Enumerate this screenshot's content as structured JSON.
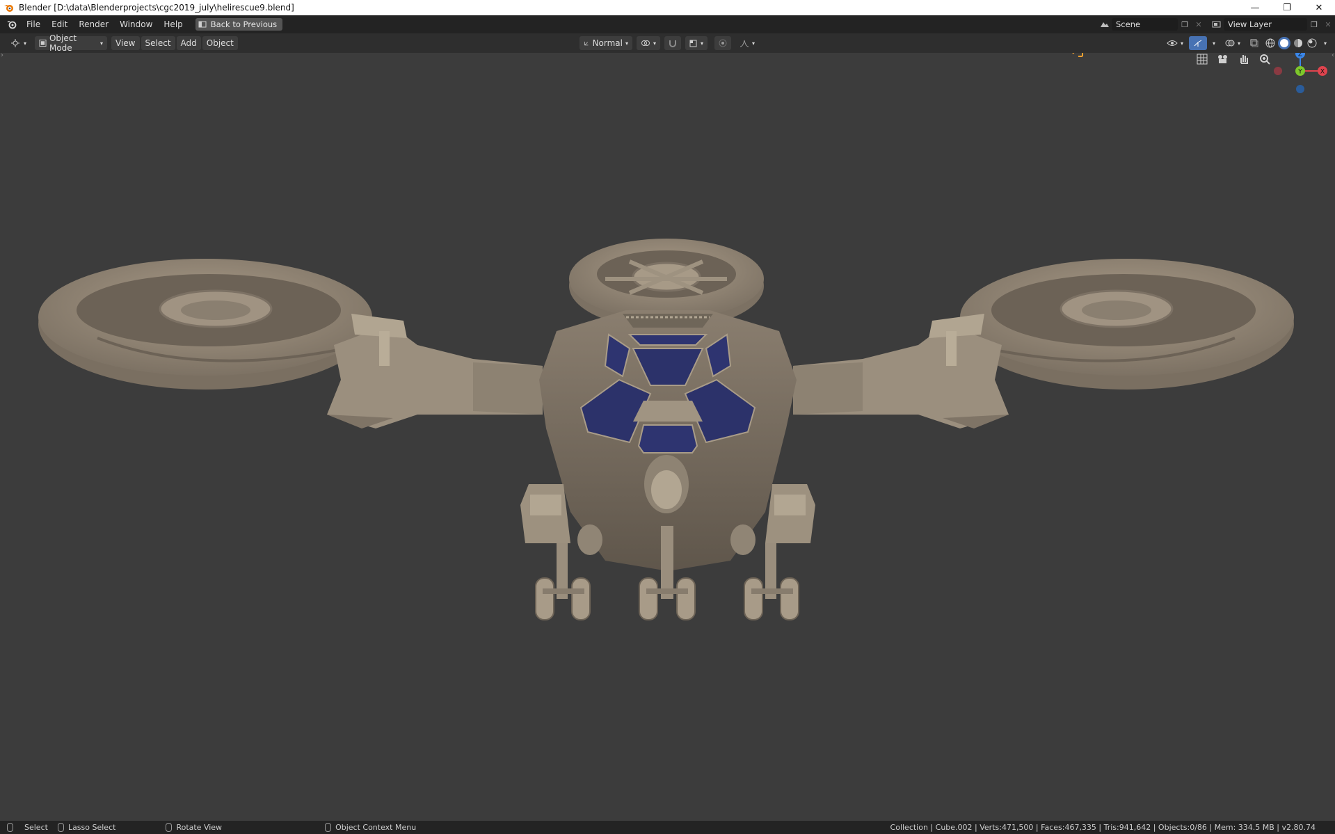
{
  "window": {
    "title": "Blender [D:\\data\\Blenderprojects\\cgc2019_july\\helirescue9.blend]",
    "controls": {
      "minimize": "—",
      "restore": "❐",
      "close": "✕"
    }
  },
  "topbar": {
    "menu": [
      "File",
      "Edit",
      "Render",
      "Window",
      "Help"
    ],
    "back_button": "Back to Previous",
    "scene_name": "Scene",
    "view_layer_name": "View Layer"
  },
  "viewport_header": {
    "editor_type_icon": "3d-viewport-icon",
    "mode": "Object Mode",
    "menus": [
      "View",
      "Select",
      "Add",
      "Object"
    ],
    "orientation": "Normal",
    "pivot_icon": "pivot-icon",
    "snap_icon": "magnet-icon",
    "proportional_icon": "proportional-edit-icon",
    "shading_mode": "solid"
  },
  "viewport": {
    "gizmo_labels": {
      "z": "Z",
      "y": "Y",
      "x": "X"
    },
    "nav_tools": [
      "grid-icon",
      "camera-icon",
      "hand-icon",
      "zoom-icon"
    ],
    "colors": {
      "background": "#3c3c3c",
      "model": "#9a8d7c",
      "glass": "#2e3470",
      "axis_x": "#e0444e",
      "axis_y": "#7ec72b",
      "axis_z": "#3a86e8"
    }
  },
  "statusbar": {
    "select": "Select",
    "lasso_select": "Lasso Select",
    "rotate_view": "Rotate View",
    "context_menu": "Object Context Menu",
    "stats": "Collection | Cube.002 | Verts:471,500 | Faces:467,335 | Tris:941,642 | Objects:0/86 | Mem: 334.5 MB | v2.80.74"
  }
}
